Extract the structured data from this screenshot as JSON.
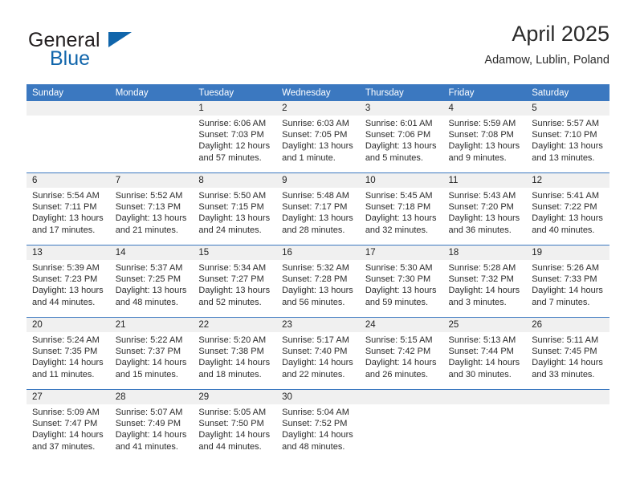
{
  "brand": {
    "name_part1": "General",
    "name_part2": "Blue",
    "logo_icon": "triangle-icon"
  },
  "header": {
    "title": "April 2025",
    "location": "Adamow, Lublin, Poland"
  },
  "colors": {
    "header_blue": "#3b78c0",
    "brand_blue": "#1065ab",
    "daynum_band": "#f0f0f0",
    "text": "#2b2b2b"
  },
  "weekdays": [
    "Sunday",
    "Monday",
    "Tuesday",
    "Wednesday",
    "Thursday",
    "Friday",
    "Saturday"
  ],
  "weeks": [
    [
      {
        "day": "",
        "lines": []
      },
      {
        "day": "",
        "lines": []
      },
      {
        "day": "1",
        "lines": [
          "Sunrise: 6:06 AM",
          "Sunset: 7:03 PM",
          "Daylight: 12 hours",
          "and 57 minutes."
        ]
      },
      {
        "day": "2",
        "lines": [
          "Sunrise: 6:03 AM",
          "Sunset: 7:05 PM",
          "Daylight: 13 hours",
          "and 1 minute."
        ]
      },
      {
        "day": "3",
        "lines": [
          "Sunrise: 6:01 AM",
          "Sunset: 7:06 PM",
          "Daylight: 13 hours",
          "and 5 minutes."
        ]
      },
      {
        "day": "4",
        "lines": [
          "Sunrise: 5:59 AM",
          "Sunset: 7:08 PM",
          "Daylight: 13 hours",
          "and 9 minutes."
        ]
      },
      {
        "day": "5",
        "lines": [
          "Sunrise: 5:57 AM",
          "Sunset: 7:10 PM",
          "Daylight: 13 hours",
          "and 13 minutes."
        ]
      }
    ],
    [
      {
        "day": "6",
        "lines": [
          "Sunrise: 5:54 AM",
          "Sunset: 7:11 PM",
          "Daylight: 13 hours",
          "and 17 minutes."
        ]
      },
      {
        "day": "7",
        "lines": [
          "Sunrise: 5:52 AM",
          "Sunset: 7:13 PM",
          "Daylight: 13 hours",
          "and 21 minutes."
        ]
      },
      {
        "day": "8",
        "lines": [
          "Sunrise: 5:50 AM",
          "Sunset: 7:15 PM",
          "Daylight: 13 hours",
          "and 24 minutes."
        ]
      },
      {
        "day": "9",
        "lines": [
          "Sunrise: 5:48 AM",
          "Sunset: 7:17 PM",
          "Daylight: 13 hours",
          "and 28 minutes."
        ]
      },
      {
        "day": "10",
        "lines": [
          "Sunrise: 5:45 AM",
          "Sunset: 7:18 PM",
          "Daylight: 13 hours",
          "and 32 minutes."
        ]
      },
      {
        "day": "11",
        "lines": [
          "Sunrise: 5:43 AM",
          "Sunset: 7:20 PM",
          "Daylight: 13 hours",
          "and 36 minutes."
        ]
      },
      {
        "day": "12",
        "lines": [
          "Sunrise: 5:41 AM",
          "Sunset: 7:22 PM",
          "Daylight: 13 hours",
          "and 40 minutes."
        ]
      }
    ],
    [
      {
        "day": "13",
        "lines": [
          "Sunrise: 5:39 AM",
          "Sunset: 7:23 PM",
          "Daylight: 13 hours",
          "and 44 minutes."
        ]
      },
      {
        "day": "14",
        "lines": [
          "Sunrise: 5:37 AM",
          "Sunset: 7:25 PM",
          "Daylight: 13 hours",
          "and 48 minutes."
        ]
      },
      {
        "day": "15",
        "lines": [
          "Sunrise: 5:34 AM",
          "Sunset: 7:27 PM",
          "Daylight: 13 hours",
          "and 52 minutes."
        ]
      },
      {
        "day": "16",
        "lines": [
          "Sunrise: 5:32 AM",
          "Sunset: 7:28 PM",
          "Daylight: 13 hours",
          "and 56 minutes."
        ]
      },
      {
        "day": "17",
        "lines": [
          "Sunrise: 5:30 AM",
          "Sunset: 7:30 PM",
          "Daylight: 13 hours",
          "and 59 minutes."
        ]
      },
      {
        "day": "18",
        "lines": [
          "Sunrise: 5:28 AM",
          "Sunset: 7:32 PM",
          "Daylight: 14 hours",
          "and 3 minutes."
        ]
      },
      {
        "day": "19",
        "lines": [
          "Sunrise: 5:26 AM",
          "Sunset: 7:33 PM",
          "Daylight: 14 hours",
          "and 7 minutes."
        ]
      }
    ],
    [
      {
        "day": "20",
        "lines": [
          "Sunrise: 5:24 AM",
          "Sunset: 7:35 PM",
          "Daylight: 14 hours",
          "and 11 minutes."
        ]
      },
      {
        "day": "21",
        "lines": [
          "Sunrise: 5:22 AM",
          "Sunset: 7:37 PM",
          "Daylight: 14 hours",
          "and 15 minutes."
        ]
      },
      {
        "day": "22",
        "lines": [
          "Sunrise: 5:20 AM",
          "Sunset: 7:38 PM",
          "Daylight: 14 hours",
          "and 18 minutes."
        ]
      },
      {
        "day": "23",
        "lines": [
          "Sunrise: 5:17 AM",
          "Sunset: 7:40 PM",
          "Daylight: 14 hours",
          "and 22 minutes."
        ]
      },
      {
        "day": "24",
        "lines": [
          "Sunrise: 5:15 AM",
          "Sunset: 7:42 PM",
          "Daylight: 14 hours",
          "and 26 minutes."
        ]
      },
      {
        "day": "25",
        "lines": [
          "Sunrise: 5:13 AM",
          "Sunset: 7:44 PM",
          "Daylight: 14 hours",
          "and 30 minutes."
        ]
      },
      {
        "day": "26",
        "lines": [
          "Sunrise: 5:11 AM",
          "Sunset: 7:45 PM",
          "Daylight: 14 hours",
          "and 33 minutes."
        ]
      }
    ],
    [
      {
        "day": "27",
        "lines": [
          "Sunrise: 5:09 AM",
          "Sunset: 7:47 PM",
          "Daylight: 14 hours",
          "and 37 minutes."
        ]
      },
      {
        "day": "28",
        "lines": [
          "Sunrise: 5:07 AM",
          "Sunset: 7:49 PM",
          "Daylight: 14 hours",
          "and 41 minutes."
        ]
      },
      {
        "day": "29",
        "lines": [
          "Sunrise: 5:05 AM",
          "Sunset: 7:50 PM",
          "Daylight: 14 hours",
          "and 44 minutes."
        ]
      },
      {
        "day": "30",
        "lines": [
          "Sunrise: 5:04 AM",
          "Sunset: 7:52 PM",
          "Daylight: 14 hours",
          "and 48 minutes."
        ]
      },
      {
        "day": "",
        "lines": []
      },
      {
        "day": "",
        "lines": []
      },
      {
        "day": "",
        "lines": []
      }
    ]
  ]
}
